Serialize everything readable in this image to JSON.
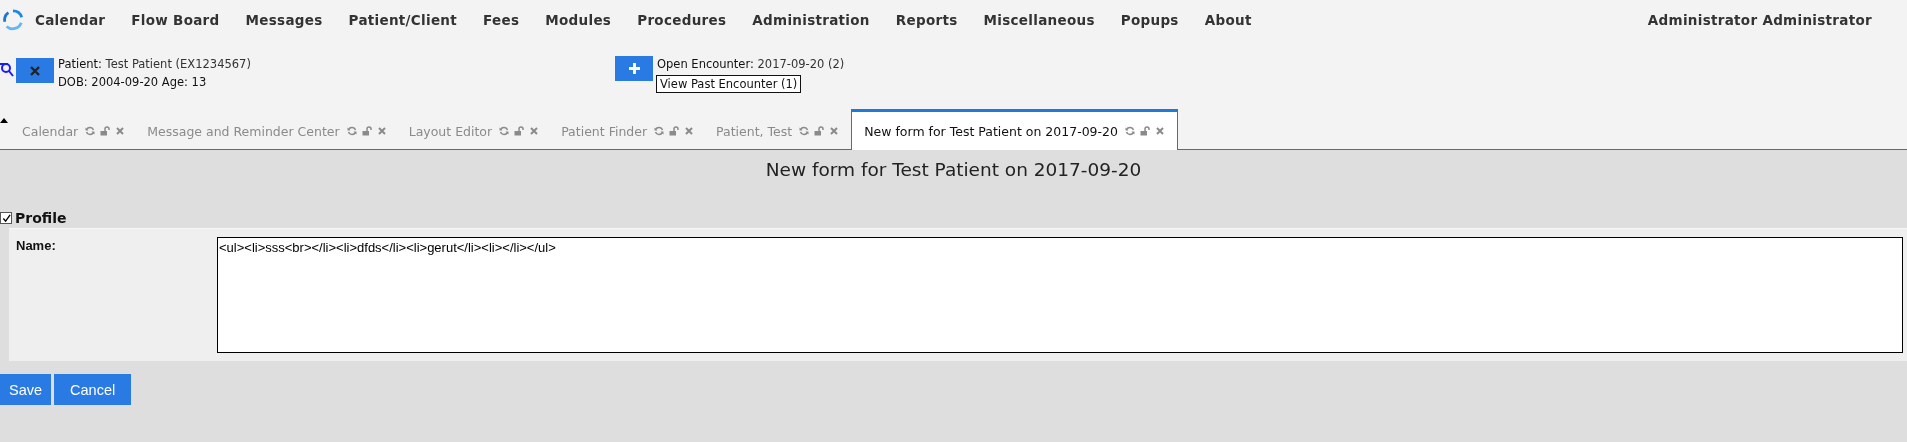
{
  "menu": [
    "Calendar",
    "Flow Board",
    "Messages",
    "Patient/Client",
    "Fees",
    "Modules",
    "Procedures",
    "Administration",
    "Reports",
    "Miscellaneous",
    "Popups",
    "About"
  ],
  "user": "Administrator Administrator",
  "patient": {
    "label": "Patient:",
    "name": "Test Patient (EX1234567)",
    "dob_label": "DOB:",
    "dob": "2004-09-20",
    "age_label": "Age:",
    "age": "13"
  },
  "encounter": {
    "label": "Open Encounter:",
    "value": "2017-09-20 (2)",
    "past": "View Past Encounter (1)"
  },
  "tabs": [
    {
      "label": "Calendar",
      "selected": false
    },
    {
      "label": "Message and Reminder Center",
      "selected": false
    },
    {
      "label": "Layout Editor",
      "selected": false
    },
    {
      "label": "Patient Finder",
      "selected": false
    },
    {
      "label": "Patient, Test",
      "selected": false
    },
    {
      "label": "New form for Test Patient on 2017-09-20",
      "selected": true
    }
  ],
  "form": {
    "title": "New form for Test Patient on 2017-09-20",
    "section": {
      "label": "Profile",
      "checked": true
    },
    "fields": [
      {
        "label": "Name:",
        "value": "<ul><li>sss<br></li><li>dfds</li><li>gerut</li><li></li></ul>"
      }
    ],
    "buttons": [
      "Save",
      "Cancel"
    ]
  }
}
